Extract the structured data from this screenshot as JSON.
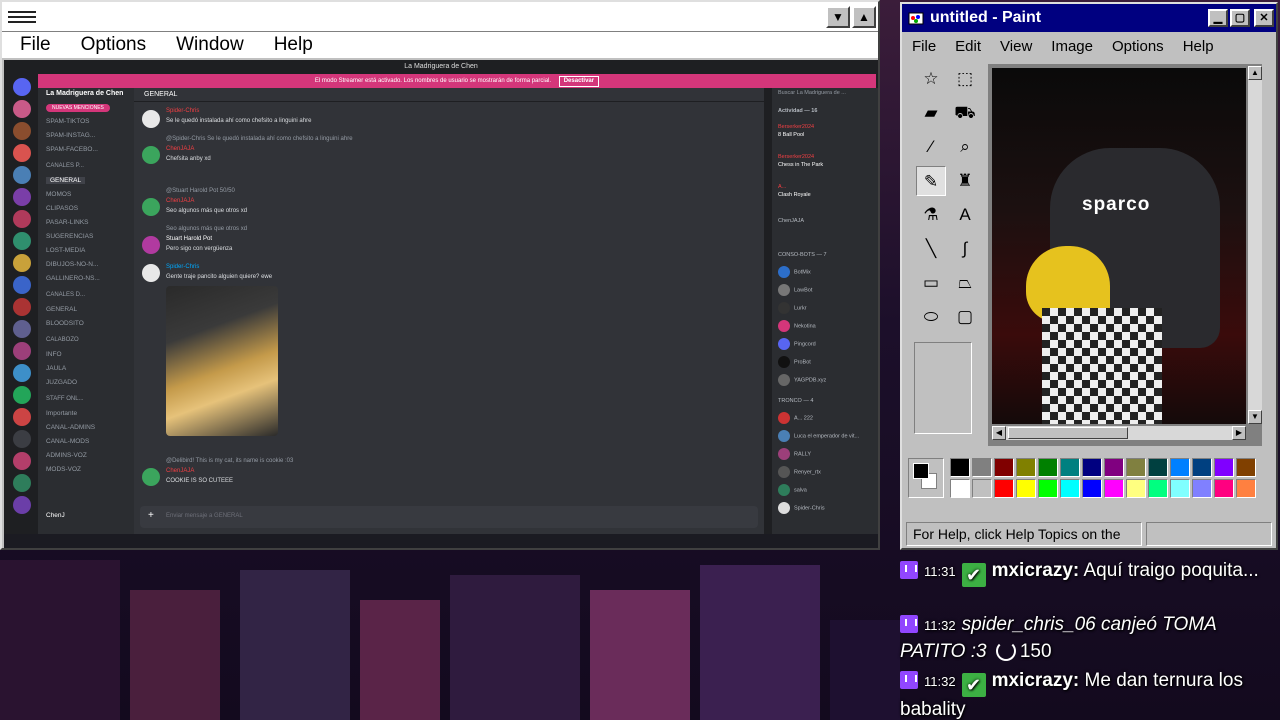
{
  "left_window": {
    "menu": [
      "File",
      "Options",
      "Window",
      "Help"
    ],
    "title_controls": [
      "▼",
      "▲"
    ]
  },
  "discord": {
    "server_name": "La Madriguera de Chen",
    "banner_text": "El modo Streamer está activado. Los nombres de usuario se mostrarán de forma parcial.",
    "banner_button": "Desactivar",
    "current_channel": "GENERAL",
    "search_placeholder": "Buscar La Madriguera de ...",
    "new_mentions": "NUEVAS MENCIONES",
    "channels": [
      "SPAM-TIKTOS",
      "SPAM-INSTAG...",
      "SPAM-FACEBO...",
      "CANALES P...",
      "GENERAL",
      "MOMOS",
      "CLIPASOS",
      "PASAR-LINKS",
      "SUGERENCIAS",
      "LOST-MEDIA",
      "DIBUJOS-NO-N...",
      "GALLINERO-NS...",
      "CANALES D...",
      "GENERAL",
      "BLOODSITO",
      "CALABOZO",
      "INFO",
      "JAULA",
      "JUZGADO",
      "STAFF ONL...",
      "Importante",
      "CANAL-ADMINS",
      "CANAL-MODS",
      "ADMINS-VOZ",
      "MODS-VOZ"
    ],
    "messages": [
      {
        "author": "Spider-Chris",
        "text": "Se le quedó instalada ahí como chefsito a linguini ahre"
      },
      {
        "author": "ChenJAJA",
        "reply": "@Spider-Chris Se le quedó instalada ahí como chefsito a linguini ahre",
        "text": "Chefsita anby xd"
      },
      {
        "author": "ChenJAJA",
        "reply": "@Stuart Harold Pot 50/50",
        "text": "Seo algunos más que otros xd"
      },
      {
        "author": "Stuart Harold Pot",
        "reply": "Seo algunos más que otros xd",
        "text": "Pero sigo con vergüenza"
      },
      {
        "author": "Spider-Chris",
        "text": "Gente traje pancito alguien quiere? ewe"
      },
      {
        "author": "ChenJAJA",
        "reply": "@Delibird! This is my cat, its name is cookie :03",
        "text": "COOKIE IS SO CUTEEE"
      }
    ],
    "input_placeholder": "Enviar mensaje a GENERAL",
    "user_panel_name": "ChenJ",
    "members": {
      "activity_header": "Actividad — 16",
      "activities": [
        {
          "user": "Berserker2024",
          "game": "8 Ball Pool"
        },
        {
          "user": "Berserker2024",
          "game": "Chess in The Park"
        },
        {
          "user": "A...",
          "game": "Clash Royale"
        }
      ],
      "groups": [
        "ChenJAJA",
        "CONSO-BOTS — 7",
        "TRONCO — 4"
      ],
      "bots": [
        "BotMix",
        "LawBot",
        "Lurkr",
        "Nekotina",
        "Pingcord",
        "ProBot",
        "YAGPDB.xyz"
      ],
      "people": [
        "A... 222",
        "Luca el emperador de vit...",
        "RALLY",
        "Renyer_rtx",
        "salva",
        "Spider-Chris"
      ]
    }
  },
  "paint": {
    "title": "untitled - Paint",
    "menu": [
      "File",
      "Edit",
      "View",
      "Image",
      "Options",
      "Help"
    ],
    "status_text": "For Help, click Help Topics on the",
    "canvas_text": "sparco",
    "palette": [
      "#000000",
      "#808080",
      "#800000",
      "#808000",
      "#008000",
      "#008080",
      "#000080",
      "#800080",
      "#808040",
      "#004040",
      "#0080ff",
      "#004080",
      "#8000ff",
      "#804000",
      "#ffffff",
      "#c0c0c0",
      "#ff0000",
      "#ffff00",
      "#00ff00",
      "#00ffff",
      "#0000ff",
      "#ff00ff",
      "#ffff80",
      "#00ff80",
      "#80ffff",
      "#8080ff",
      "#ff0080",
      "#ff8040"
    ]
  },
  "chat": {
    "cut_line": "...",
    "lines": [
      {
        "time": "11:31",
        "badge": true,
        "user": "mxicrazy:",
        "text": "Aquí traigo poquita..."
      },
      {
        "time": "11:32",
        "badge": false,
        "user": "",
        "text": "spider_chris_06 canjeó TOMA PATITO :3",
        "points": "150"
      },
      {
        "time": "11:32",
        "badge": true,
        "user": "mxicrazy:",
        "text": "Me dan ternura los babality"
      }
    ]
  },
  "colors": {
    "discord_bg": "#313338",
    "paint_title": "#000080",
    "banner": "#d4367a",
    "twitch": "#9146ff"
  }
}
